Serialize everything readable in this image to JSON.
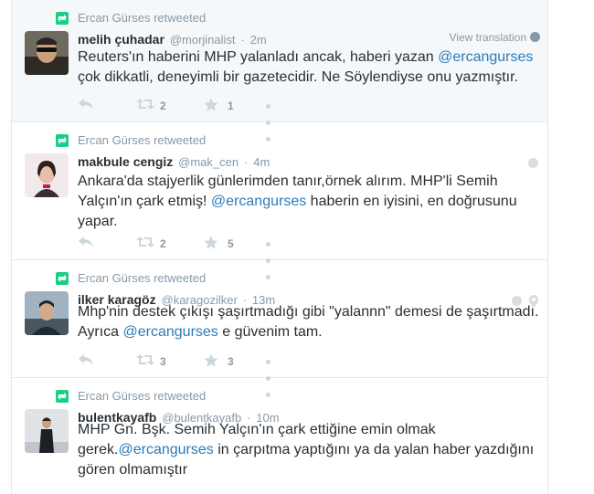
{
  "colors": {
    "accent": "#2b7bb9",
    "muted": "#8899a6",
    "retweet_green": "#19cf86",
    "icon_gray": "#ccd6dd"
  },
  "tweets": [
    {
      "retweet_context": "Ercan Gürses retweeted",
      "fullname": "melih çuhadar",
      "username": "@morjinalist",
      "time": "2m",
      "view_translation": "View translation",
      "text_parts": [
        "Reuters'ın haberini MHP yalanladı ancak, haberi yazan ",
        "@ercangurses",
        " çok dikkatli, deneyimli bir gazetecidir. Ne Söylendiyse onu yazmıştır."
      ],
      "retweet_count": "2",
      "favorite_count": "1"
    },
    {
      "retweet_context": "Ercan Gürses retweeted",
      "fullname": "makbule cengiz",
      "username": "@mak_cen",
      "time": "4m",
      "text_parts": [
        "Ankara'da stajyerlik günlerimden tanır,örnek alırım. MHP'li Semih Yalçın'ın çark etmiş! ",
        "@ercangurses",
        " haberin en iyisini, en doğrusunu yapar."
      ],
      "retweet_count": "2",
      "favorite_count": "5"
    },
    {
      "retweet_context": "Ercan Gürses retweeted",
      "fullname": "ilker karagöz",
      "username": "@karagozilker",
      "time": "13m",
      "text_parts": [
        "Mhp'nin destek çıkışı şaşırtmadığı gibi \"yalannn\" demesi de şaşırtmadı. Ayrıca ",
        "@ercangurses",
        " e güvenim tam."
      ],
      "retweet_count": "3",
      "favorite_count": "3"
    },
    {
      "retweet_context": "Ercan Gürses retweeted",
      "fullname": "bulentkayafb",
      "username": "@bulentkayafb",
      "time": "10m",
      "text_parts": [
        "MHP Gn. Bşk. Semih Yalçın'ın çark ettiğine emin olmak gerek.",
        "@ercangurses",
        " in  çarpıtma yaptığını ya da yalan haber yazdığını gören olmamıştır"
      ]
    }
  ]
}
